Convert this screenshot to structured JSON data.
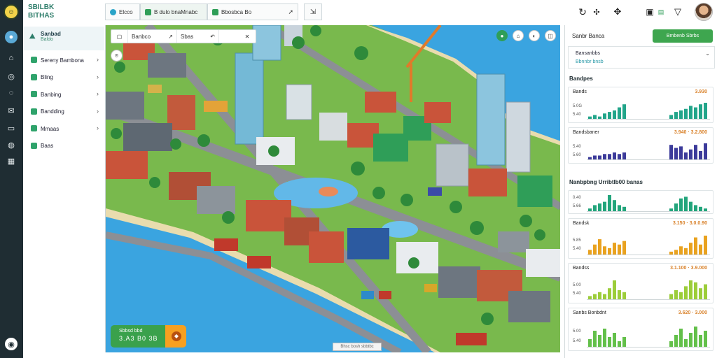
{
  "brand": {
    "line1": "SBILBK",
    "line2": "BITHAS"
  },
  "header": {
    "tabs": [
      {
        "label": "Elcco"
      },
      {
        "label": "B dulo bnaMnabc"
      },
      {
        "label": "Bbosbca Bo"
      },
      {
        "label": ""
      },
      {
        "label": ""
      }
    ]
  },
  "nav": {
    "header_title": "Sanbad",
    "header_sub": "Baldo",
    "items": [
      {
        "label": "Sereny Bambona"
      },
      {
        "label": "Bling"
      },
      {
        "label": "Banbing"
      },
      {
        "label": "Bandding"
      },
      {
        "label": "Mmaas"
      },
      {
        "label": "Baas"
      }
    ]
  },
  "map_toolbar": {
    "btn1": "Banbco",
    "btn2": "Sbas"
  },
  "promo": {
    "title": "Sbbsd bbd",
    "value": "3.A3 B0 3B"
  },
  "scale_chip": "Bhsc bosh sbbtbc",
  "panel": {
    "title": "Sanbr Banca",
    "button": "Bmbenb Sbrbs",
    "filter_line1": "Bansanbbs",
    "filter_line2": "Bbnnbr bnsb",
    "section1": "Bandpes",
    "section2": "Nanbpbng Urribtlb00 banas",
    "cards": [
      {
        "name": "Bands",
        "value": "3.930",
        "ax_top": "5.0G",
        "ax_bottom": "5.40",
        "color": "#22a58a",
        "left": [
          2,
          3,
          2,
          4,
          5,
          6,
          8,
          10
        ],
        "right": [
          3,
          5,
          6,
          7,
          9,
          8,
          10,
          11
        ]
      },
      {
        "name": "Bandsbaner",
        "value": "3.940 · 3.2.800",
        "ax_top": "5.40",
        "ax_bottom": "5.60",
        "color": "#3c3b9a",
        "left": [
          2,
          3,
          3,
          4,
          4,
          5,
          4,
          5
        ],
        "right": [
          10,
          8,
          9,
          5,
          7,
          10,
          6,
          11
        ]
      },
      {
        "name": "",
        "value": "",
        "ax_top": "0.40",
        "ax_bottom": "5.66",
        "color": "#23a57c",
        "left": [
          2,
          4,
          5,
          6,
          10,
          7,
          4,
          3
        ],
        "right": [
          2,
          5,
          8,
          9,
          6,
          4,
          3,
          2
        ]
      },
      {
        "name": "Bandsk",
        "value": "3.150 · 3.0.0.90",
        "ax_top": "5.85",
        "ax_bottom": "5.40",
        "color": "#e9a21f",
        "left": [
          3,
          6,
          9,
          5,
          4,
          7,
          6,
          8
        ],
        "right": [
          2,
          3,
          5,
          4,
          7,
          10,
          6,
          11
        ]
      },
      {
        "name": "Bandss",
        "value": "3.1.100 · 3.9.000",
        "ax_top": "5.00",
        "ax_bottom": "5.40",
        "color": "#9ccd3a",
        "left": [
          2,
          3,
          4,
          3,
          6,
          10,
          5,
          4
        ],
        "right": [
          3,
          5,
          4,
          7,
          10,
          9,
          6,
          8
        ]
      },
      {
        "name": "Sanbs Bonbdnt",
        "value": "3.620 · 3.000",
        "ax_top": "5.00",
        "ax_bottom": "5.40",
        "color": "#63c04a",
        "left": [
          4,
          8,
          6,
          9,
          5,
          7,
          3,
          5
        ],
        "right": [
          3,
          6,
          9,
          4,
          7,
          10,
          6,
          8
        ]
      }
    ]
  },
  "colors": {
    "accent_green": "#3ea64f",
    "rail": "#1f2d33",
    "water": "#3aa4e0"
  }
}
